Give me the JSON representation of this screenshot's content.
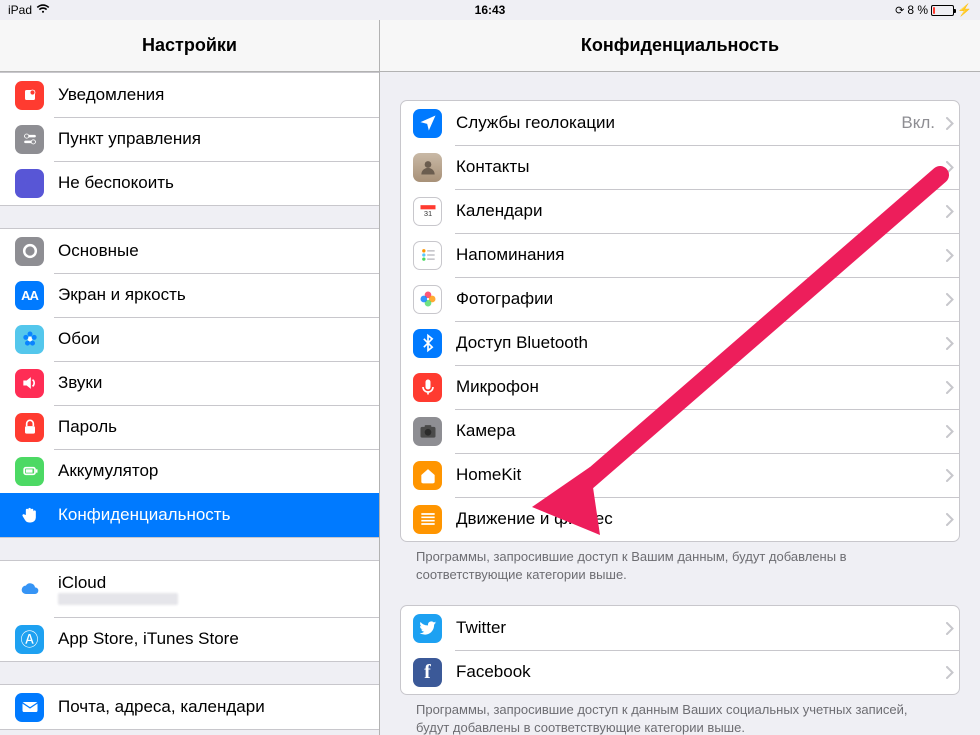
{
  "status": {
    "device": "iPad",
    "time": "16:43",
    "battery_pct": "8 %",
    "charging_glyph": "⚡"
  },
  "sidebar": {
    "title": "Настройки",
    "groups": [
      {
        "items": [
          {
            "id": "notifications",
            "label": "Уведомления",
            "icon": "bell",
            "bg": "#ff3b30"
          },
          {
            "id": "control-center",
            "label": "Пункт управления",
            "icon": "toggles",
            "bg": "#8e8e93"
          },
          {
            "id": "dnd",
            "label": "Не беспокоить",
            "icon": "moon",
            "bg": "#5856d6"
          }
        ]
      },
      {
        "items": [
          {
            "id": "general",
            "label": "Основные",
            "icon": "gear",
            "bg": "#8e8e93"
          },
          {
            "id": "display",
            "label": "Экран и яркость",
            "icon": "aa",
            "bg": "#007aff"
          },
          {
            "id": "wallpaper",
            "label": "Обои",
            "icon": "flower",
            "bg": "#54c7ec"
          },
          {
            "id": "sounds",
            "label": "Звуки",
            "icon": "speaker",
            "bg": "#ff2d55"
          },
          {
            "id": "passcode",
            "label": "Пароль",
            "icon": "lock",
            "bg": "#ff3b30"
          },
          {
            "id": "battery",
            "label": "Аккумулятор",
            "icon": "battery",
            "bg": "#4cd964"
          },
          {
            "id": "privacy",
            "label": "Конфиденциальность",
            "icon": "hand",
            "bg": "#007aff",
            "selected": true
          }
        ]
      },
      {
        "items": [
          {
            "id": "icloud",
            "label": "iCloud",
            "icon": "cloud",
            "bg": "transparent",
            "type": "icloud"
          },
          {
            "id": "stores",
            "label": "App Store, iTunes Store",
            "icon": "appstore",
            "bg": "#1ea1f1"
          }
        ]
      },
      {
        "items": [
          {
            "id": "mail",
            "label": "Почта, адреса, календари",
            "icon": "mail",
            "bg": "#007aff"
          }
        ]
      }
    ]
  },
  "detail": {
    "title": "Конфиденциальность",
    "groups": [
      {
        "items": [
          {
            "id": "location",
            "label": "Службы геолокации",
            "icon": "location",
            "bg": "#007aff",
            "value": "Вкл."
          },
          {
            "id": "contacts",
            "label": "Контакты",
            "icon": "contacts",
            "bg": "#b8a48f"
          },
          {
            "id": "calendars",
            "label": "Календари",
            "icon": "calendar",
            "bg": "#ffffff",
            "border": true
          },
          {
            "id": "reminders",
            "label": "Напоминания",
            "icon": "reminders",
            "bg": "#ffffff",
            "border": true
          },
          {
            "id": "photos",
            "label": "Фотографии",
            "icon": "photos",
            "bg": "#ffffff",
            "border": true
          },
          {
            "id": "bluetooth",
            "label": "Доступ Bluetooth",
            "icon": "bluetooth",
            "bg": "#007aff"
          },
          {
            "id": "microphone",
            "label": "Микрофон",
            "icon": "mic",
            "bg": "#ff3b30"
          },
          {
            "id": "camera",
            "label": "Камера",
            "icon": "camera",
            "bg": "#8e8e93"
          },
          {
            "id": "homekit",
            "label": "HomeKit",
            "icon": "home",
            "bg": "#ff9500"
          },
          {
            "id": "motion",
            "label": "Движение и фитнес",
            "icon": "motion",
            "bg": "#ff9500"
          }
        ],
        "footer": "Программы, запросившие доступ к Вашим данным, будут добавлены в соответствующие категории выше."
      },
      {
        "items": [
          {
            "id": "twitter",
            "label": "Twitter",
            "icon": "twitter",
            "bg": "#1da1f2"
          },
          {
            "id": "facebook",
            "label": "Facebook",
            "icon": "facebook",
            "bg": "#3b5998"
          }
        ],
        "footer": "Программы, запросившие доступ к данным Ваших социальных учетных записей, будут добавлены в соответствующие категории выше."
      }
    ]
  }
}
